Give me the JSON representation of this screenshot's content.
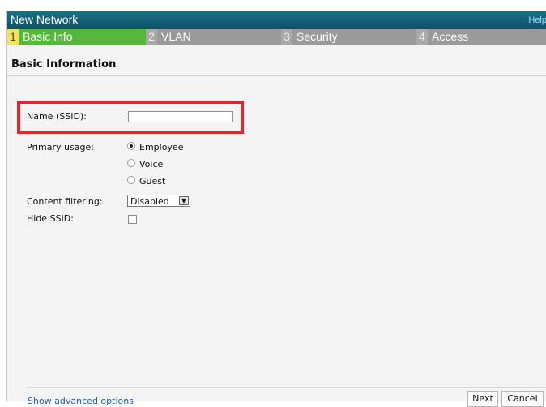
{
  "window": {
    "title": "New Network",
    "help_link": "Help"
  },
  "steps": [
    {
      "num": "1",
      "label": "Basic Info"
    },
    {
      "num": "2",
      "label": "VLAN"
    },
    {
      "num": "3",
      "label": "Security"
    },
    {
      "num": "4",
      "label": "Access"
    }
  ],
  "section_title": "Basic Information",
  "form": {
    "name_label": "Name (SSID):",
    "name_value": "",
    "primary_usage_label": "Primary usage:",
    "usage_options": [
      "Employee",
      "Voice",
      "Guest"
    ],
    "usage_selected": "Employee",
    "content_filter_label": "Content filtering:",
    "content_filter_value": "Disabled",
    "hide_ssid_label": "Hide SSID:",
    "hide_ssid_checked": false
  },
  "footer": {
    "advanced_link": "Show advanced options",
    "next_label": "Next",
    "cancel_label": "Cancel"
  },
  "colors": {
    "titlebar": "#0d5266",
    "active_step": "#55b83a",
    "active_step_number": "#f6e25a",
    "highlight": "#e0262d"
  }
}
